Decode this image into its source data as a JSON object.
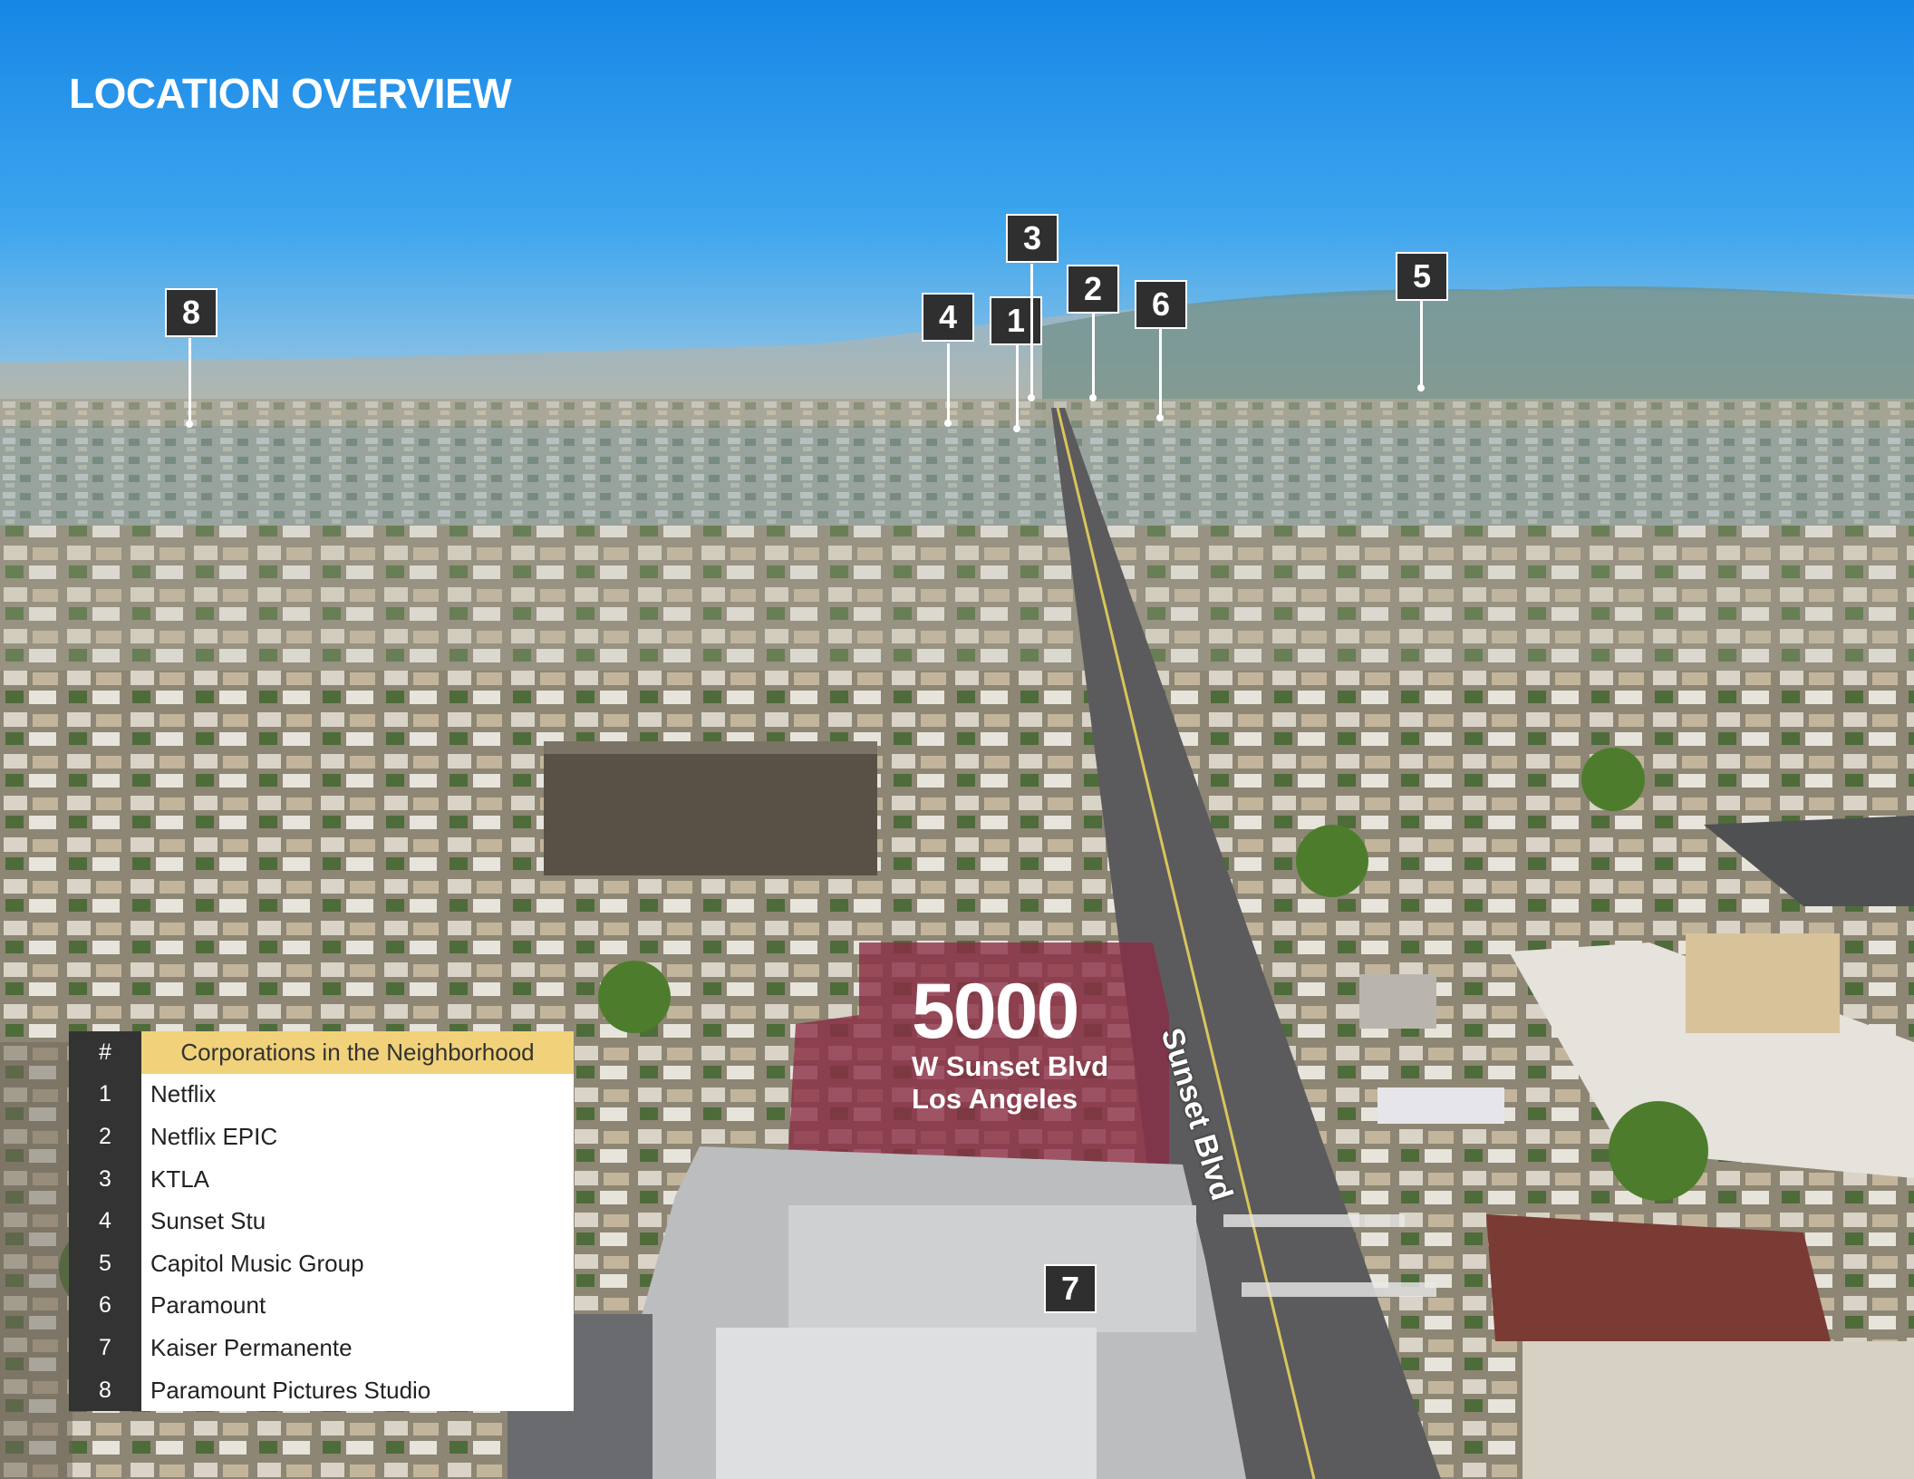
{
  "page": {
    "title": "LOCATION OVERVIEW"
  },
  "colors": {
    "sky": "#1e8fe0",
    "marker_bg": "#2f2f2f",
    "legend_header": "#f1d27a",
    "legend_index_bg": "#333333",
    "highlight_building": "#8b2b45"
  },
  "markers": [
    {
      "label": "1"
    },
    {
      "label": "2"
    },
    {
      "label": "3"
    },
    {
      "label": "4"
    },
    {
      "label": "5"
    },
    {
      "label": "6"
    },
    {
      "label": "7"
    },
    {
      "label": "8"
    }
  ],
  "property": {
    "number": "5000",
    "street": "W Sunset Blvd",
    "city": "Los Angeles"
  },
  "street_label": "Sunset Blvd",
  "legend": {
    "index_header": "#",
    "title_header": "Corporations in the Neighborhood",
    "items": [
      {
        "index": "1",
        "name": "Netflix"
      },
      {
        "index": "2",
        "name": "Netflix EPIC"
      },
      {
        "index": "3",
        "name": "KTLA"
      },
      {
        "index": "4",
        "name": "Sunset Stu"
      },
      {
        "index": "5",
        "name": "Capitol Music Group"
      },
      {
        "index": "6",
        "name": "Paramount"
      },
      {
        "index": "7",
        "name": "Kaiser Permanente"
      },
      {
        "index": "8",
        "name": "Paramount Pictures Studio"
      }
    ]
  }
}
